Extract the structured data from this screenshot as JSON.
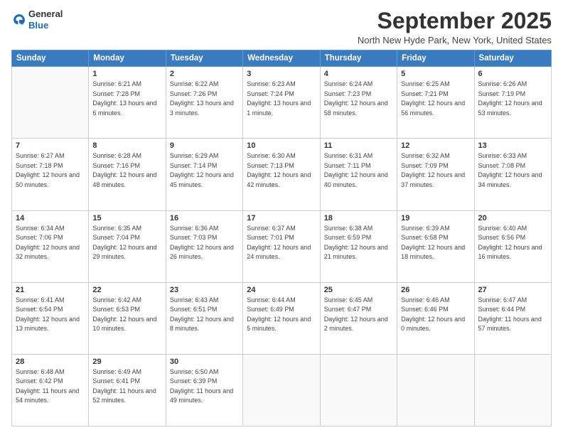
{
  "header": {
    "logo": {
      "line1": "General",
      "line2": "Blue"
    },
    "title": "September 2025",
    "location": "North New Hyde Park, New York, United States"
  },
  "weekdays": [
    "Sunday",
    "Monday",
    "Tuesday",
    "Wednesday",
    "Thursday",
    "Friday",
    "Saturday"
  ],
  "weeks": [
    [
      {
        "day": "",
        "sunrise": "",
        "sunset": "",
        "daylight": ""
      },
      {
        "day": "1",
        "sunrise": "Sunrise: 6:21 AM",
        "sunset": "Sunset: 7:28 PM",
        "daylight": "Daylight: 13 hours and 6 minutes."
      },
      {
        "day": "2",
        "sunrise": "Sunrise: 6:22 AM",
        "sunset": "Sunset: 7:26 PM",
        "daylight": "Daylight: 13 hours and 3 minutes."
      },
      {
        "day": "3",
        "sunrise": "Sunrise: 6:23 AM",
        "sunset": "Sunset: 7:24 PM",
        "daylight": "Daylight: 13 hours and 1 minute."
      },
      {
        "day": "4",
        "sunrise": "Sunrise: 6:24 AM",
        "sunset": "Sunset: 7:23 PM",
        "daylight": "Daylight: 12 hours and 58 minutes."
      },
      {
        "day": "5",
        "sunrise": "Sunrise: 6:25 AM",
        "sunset": "Sunset: 7:21 PM",
        "daylight": "Daylight: 12 hours and 56 minutes."
      },
      {
        "day": "6",
        "sunrise": "Sunrise: 6:26 AM",
        "sunset": "Sunset: 7:19 PM",
        "daylight": "Daylight: 12 hours and 53 minutes."
      }
    ],
    [
      {
        "day": "7",
        "sunrise": "Sunrise: 6:27 AM",
        "sunset": "Sunset: 7:18 PM",
        "daylight": "Daylight: 12 hours and 50 minutes."
      },
      {
        "day": "8",
        "sunrise": "Sunrise: 6:28 AM",
        "sunset": "Sunset: 7:16 PM",
        "daylight": "Daylight: 12 hours and 48 minutes."
      },
      {
        "day": "9",
        "sunrise": "Sunrise: 6:29 AM",
        "sunset": "Sunset: 7:14 PM",
        "daylight": "Daylight: 12 hours and 45 minutes."
      },
      {
        "day": "10",
        "sunrise": "Sunrise: 6:30 AM",
        "sunset": "Sunset: 7:13 PM",
        "daylight": "Daylight: 12 hours and 42 minutes."
      },
      {
        "day": "11",
        "sunrise": "Sunrise: 6:31 AM",
        "sunset": "Sunset: 7:11 PM",
        "daylight": "Daylight: 12 hours and 40 minutes."
      },
      {
        "day": "12",
        "sunrise": "Sunrise: 6:32 AM",
        "sunset": "Sunset: 7:09 PM",
        "daylight": "Daylight: 12 hours and 37 minutes."
      },
      {
        "day": "13",
        "sunrise": "Sunrise: 6:33 AM",
        "sunset": "Sunset: 7:08 PM",
        "daylight": "Daylight: 12 hours and 34 minutes."
      }
    ],
    [
      {
        "day": "14",
        "sunrise": "Sunrise: 6:34 AM",
        "sunset": "Sunset: 7:06 PM",
        "daylight": "Daylight: 12 hours and 32 minutes."
      },
      {
        "day": "15",
        "sunrise": "Sunrise: 6:35 AM",
        "sunset": "Sunset: 7:04 PM",
        "daylight": "Daylight: 12 hours and 29 minutes."
      },
      {
        "day": "16",
        "sunrise": "Sunrise: 6:36 AM",
        "sunset": "Sunset: 7:03 PM",
        "daylight": "Daylight: 12 hours and 26 minutes."
      },
      {
        "day": "17",
        "sunrise": "Sunrise: 6:37 AM",
        "sunset": "Sunset: 7:01 PM",
        "daylight": "Daylight: 12 hours and 24 minutes."
      },
      {
        "day": "18",
        "sunrise": "Sunrise: 6:38 AM",
        "sunset": "Sunset: 6:59 PM",
        "daylight": "Daylight: 12 hours and 21 minutes."
      },
      {
        "day": "19",
        "sunrise": "Sunrise: 6:39 AM",
        "sunset": "Sunset: 6:58 PM",
        "daylight": "Daylight: 12 hours and 18 minutes."
      },
      {
        "day": "20",
        "sunrise": "Sunrise: 6:40 AM",
        "sunset": "Sunset: 6:56 PM",
        "daylight": "Daylight: 12 hours and 16 minutes."
      }
    ],
    [
      {
        "day": "21",
        "sunrise": "Sunrise: 6:41 AM",
        "sunset": "Sunset: 6:54 PM",
        "daylight": "Daylight: 12 hours and 13 minutes."
      },
      {
        "day": "22",
        "sunrise": "Sunrise: 6:42 AM",
        "sunset": "Sunset: 6:53 PM",
        "daylight": "Daylight: 12 hours and 10 minutes."
      },
      {
        "day": "23",
        "sunrise": "Sunrise: 6:43 AM",
        "sunset": "Sunset: 6:51 PM",
        "daylight": "Daylight: 12 hours and 8 minutes."
      },
      {
        "day": "24",
        "sunrise": "Sunrise: 6:44 AM",
        "sunset": "Sunset: 6:49 PM",
        "daylight": "Daylight: 12 hours and 5 minutes."
      },
      {
        "day": "25",
        "sunrise": "Sunrise: 6:45 AM",
        "sunset": "Sunset: 6:47 PM",
        "daylight": "Daylight: 12 hours and 2 minutes."
      },
      {
        "day": "26",
        "sunrise": "Sunrise: 6:46 AM",
        "sunset": "Sunset: 6:46 PM",
        "daylight": "Daylight: 12 hours and 0 minutes."
      },
      {
        "day": "27",
        "sunrise": "Sunrise: 6:47 AM",
        "sunset": "Sunset: 6:44 PM",
        "daylight": "Daylight: 11 hours and 57 minutes."
      }
    ],
    [
      {
        "day": "28",
        "sunrise": "Sunrise: 6:48 AM",
        "sunset": "Sunset: 6:42 PM",
        "daylight": "Daylight: 11 hours and 54 minutes."
      },
      {
        "day": "29",
        "sunrise": "Sunrise: 6:49 AM",
        "sunset": "Sunset: 6:41 PM",
        "daylight": "Daylight: 11 hours and 52 minutes."
      },
      {
        "day": "30",
        "sunrise": "Sunrise: 6:50 AM",
        "sunset": "Sunset: 6:39 PM",
        "daylight": "Daylight: 11 hours and 49 minutes."
      },
      {
        "day": "",
        "sunrise": "",
        "sunset": "",
        "daylight": ""
      },
      {
        "day": "",
        "sunrise": "",
        "sunset": "",
        "daylight": ""
      },
      {
        "day": "",
        "sunrise": "",
        "sunset": "",
        "daylight": ""
      },
      {
        "day": "",
        "sunrise": "",
        "sunset": "",
        "daylight": ""
      }
    ]
  ]
}
